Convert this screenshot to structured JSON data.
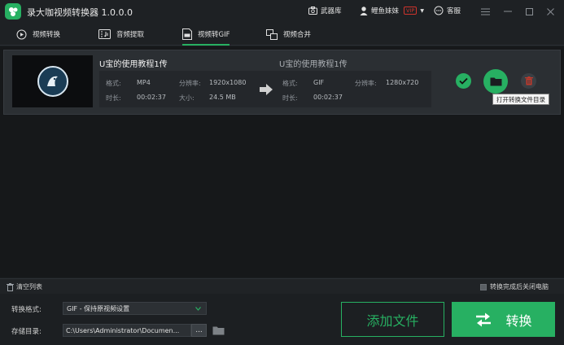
{
  "app": {
    "title": "录大咖视频转换器 1.0.0.0"
  },
  "titlebar": {
    "arsenal_label": "武器库",
    "user_name": "鲤鱼妹妹",
    "vip_badge": "VIP",
    "service_label": "客服"
  },
  "tabs": [
    {
      "label": "视频转换",
      "icon": "video-convert-icon",
      "active": false
    },
    {
      "label": "音频提取",
      "icon": "audio-extract-icon",
      "active": false
    },
    {
      "label": "视频转GIF",
      "icon": "video-to-gif-icon",
      "active": true
    },
    {
      "label": "视频合并",
      "icon": "video-merge-icon",
      "active": false
    }
  ],
  "item": {
    "source_name": "U宝的使用教程1传",
    "output_name": "U宝的使用教程1传",
    "src": {
      "format_label": "格式:",
      "format": "MP4",
      "resolution_label": "分辨率:",
      "resolution": "1920x1080",
      "duration_label": "时长:",
      "duration": "00:02:37",
      "size_label": "大小:",
      "size": "24.5 MB"
    },
    "out": {
      "format_label": "格式:",
      "format": "GIF",
      "resolution_label": "分辨率:",
      "resolution": "1280x720",
      "duration_label": "时长:",
      "duration": "00:02:37"
    }
  },
  "tooltip": "打开转换文件目录",
  "statusbar": {
    "clear_label": "清空列表",
    "shutdown_label": "转换完成后关闭电脑"
  },
  "bottom": {
    "format_label": "转换格式:",
    "format_value": "GIF - 保持原视频设置",
    "dir_label": "存储目录:",
    "dir_value": "C:\\Users\\Administrator\\Documen...",
    "browse_label": "...",
    "add_file_label": "添加文件",
    "convert_label": "转换"
  },
  "colors": {
    "accent": "#27b062",
    "delete": "#c0392b",
    "vip": "#d0342c"
  }
}
